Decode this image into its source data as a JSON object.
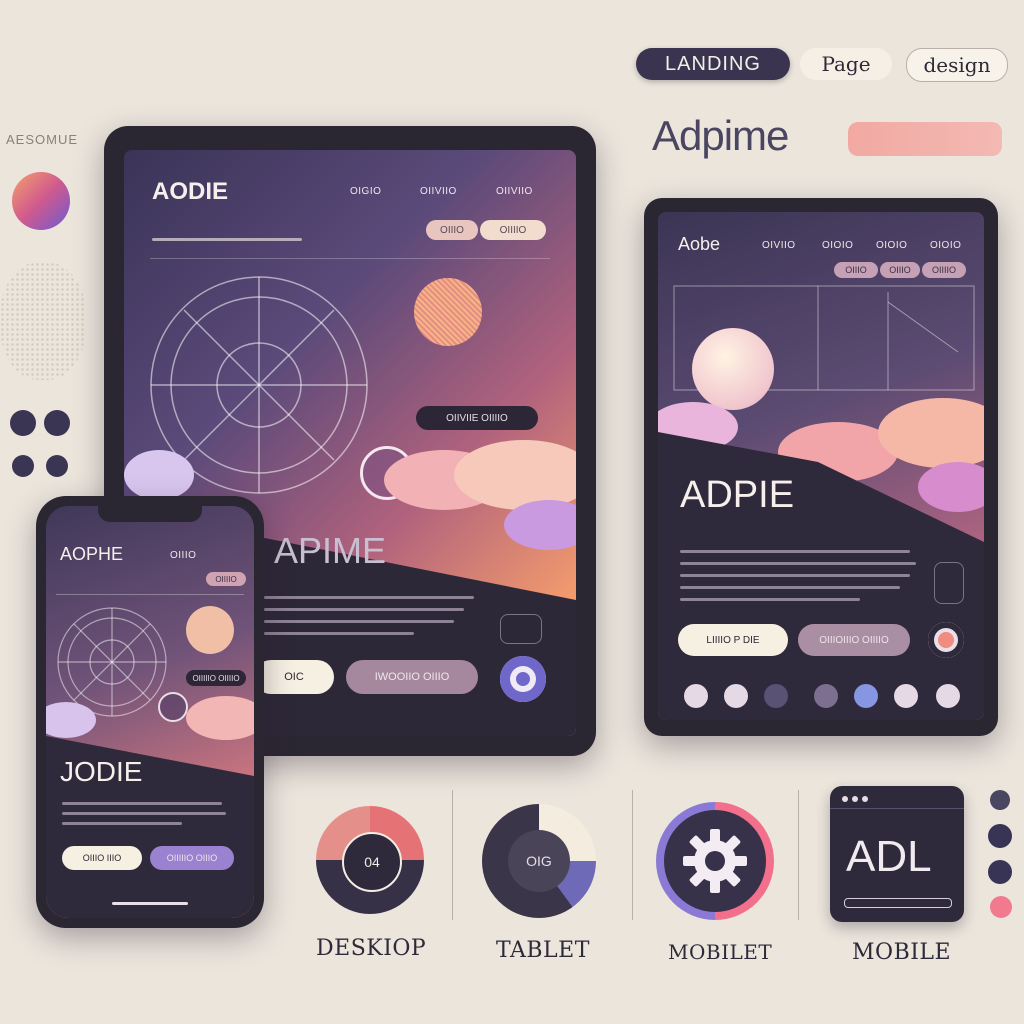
{
  "header": {
    "pill_landing": "LANDING",
    "pill_page": "Page",
    "pill_design": "design",
    "brand": "Adpime",
    "side_text": "AESOMUE"
  },
  "desktop": {
    "logo": "AODIE",
    "nav": [
      "OIGIO",
      "OIIVIIO",
      "OIIVIIO"
    ],
    "toggle": [
      "OIIIO",
      "OIIIIO"
    ],
    "cta_dark": "OIIVIIE OIIIIO",
    "heading": "APIME",
    "btn_primary": "OIC",
    "btn_secondary": "IWOOIIO OIIIO"
  },
  "tablet": {
    "logo": "Aobe",
    "nav": [
      "OIVIIO",
      "OIOIO",
      "OIOIO",
      "OIOIO"
    ],
    "toggle": [
      "OIIIO",
      "OIIIO",
      "OIIIIO"
    ],
    "heading": "ADPIE",
    "btn_primary": "LIIIIO P DIE",
    "btn_secondary": "OIIIOIIIO OIIIIO"
  },
  "mobile": {
    "logo": "AOPHE",
    "nav": [
      "OIIIO",
      "OIIIIO"
    ],
    "cta_dark": "OIIIIIO OIIIIO",
    "heading": "JODIE",
    "btn_primary": "OIIIO IIIO",
    "btn_secondary": "OIIIIIO OIIIO"
  },
  "bottom": {
    "desktop_label": "DESKIOP",
    "desktop_icon_text": "04",
    "tablet_label": "TABLET",
    "tablet_icon_text": "OIG",
    "mobilet_label": "MOBILET",
    "mobile_label": "MOBILE",
    "mobile_card_text": "ADL"
  },
  "colors": {
    "accent_pink": "#f27a8f",
    "accent_purple": "#7a6fb8",
    "navy": "#383456",
    "bg": "#ebe5dc"
  }
}
